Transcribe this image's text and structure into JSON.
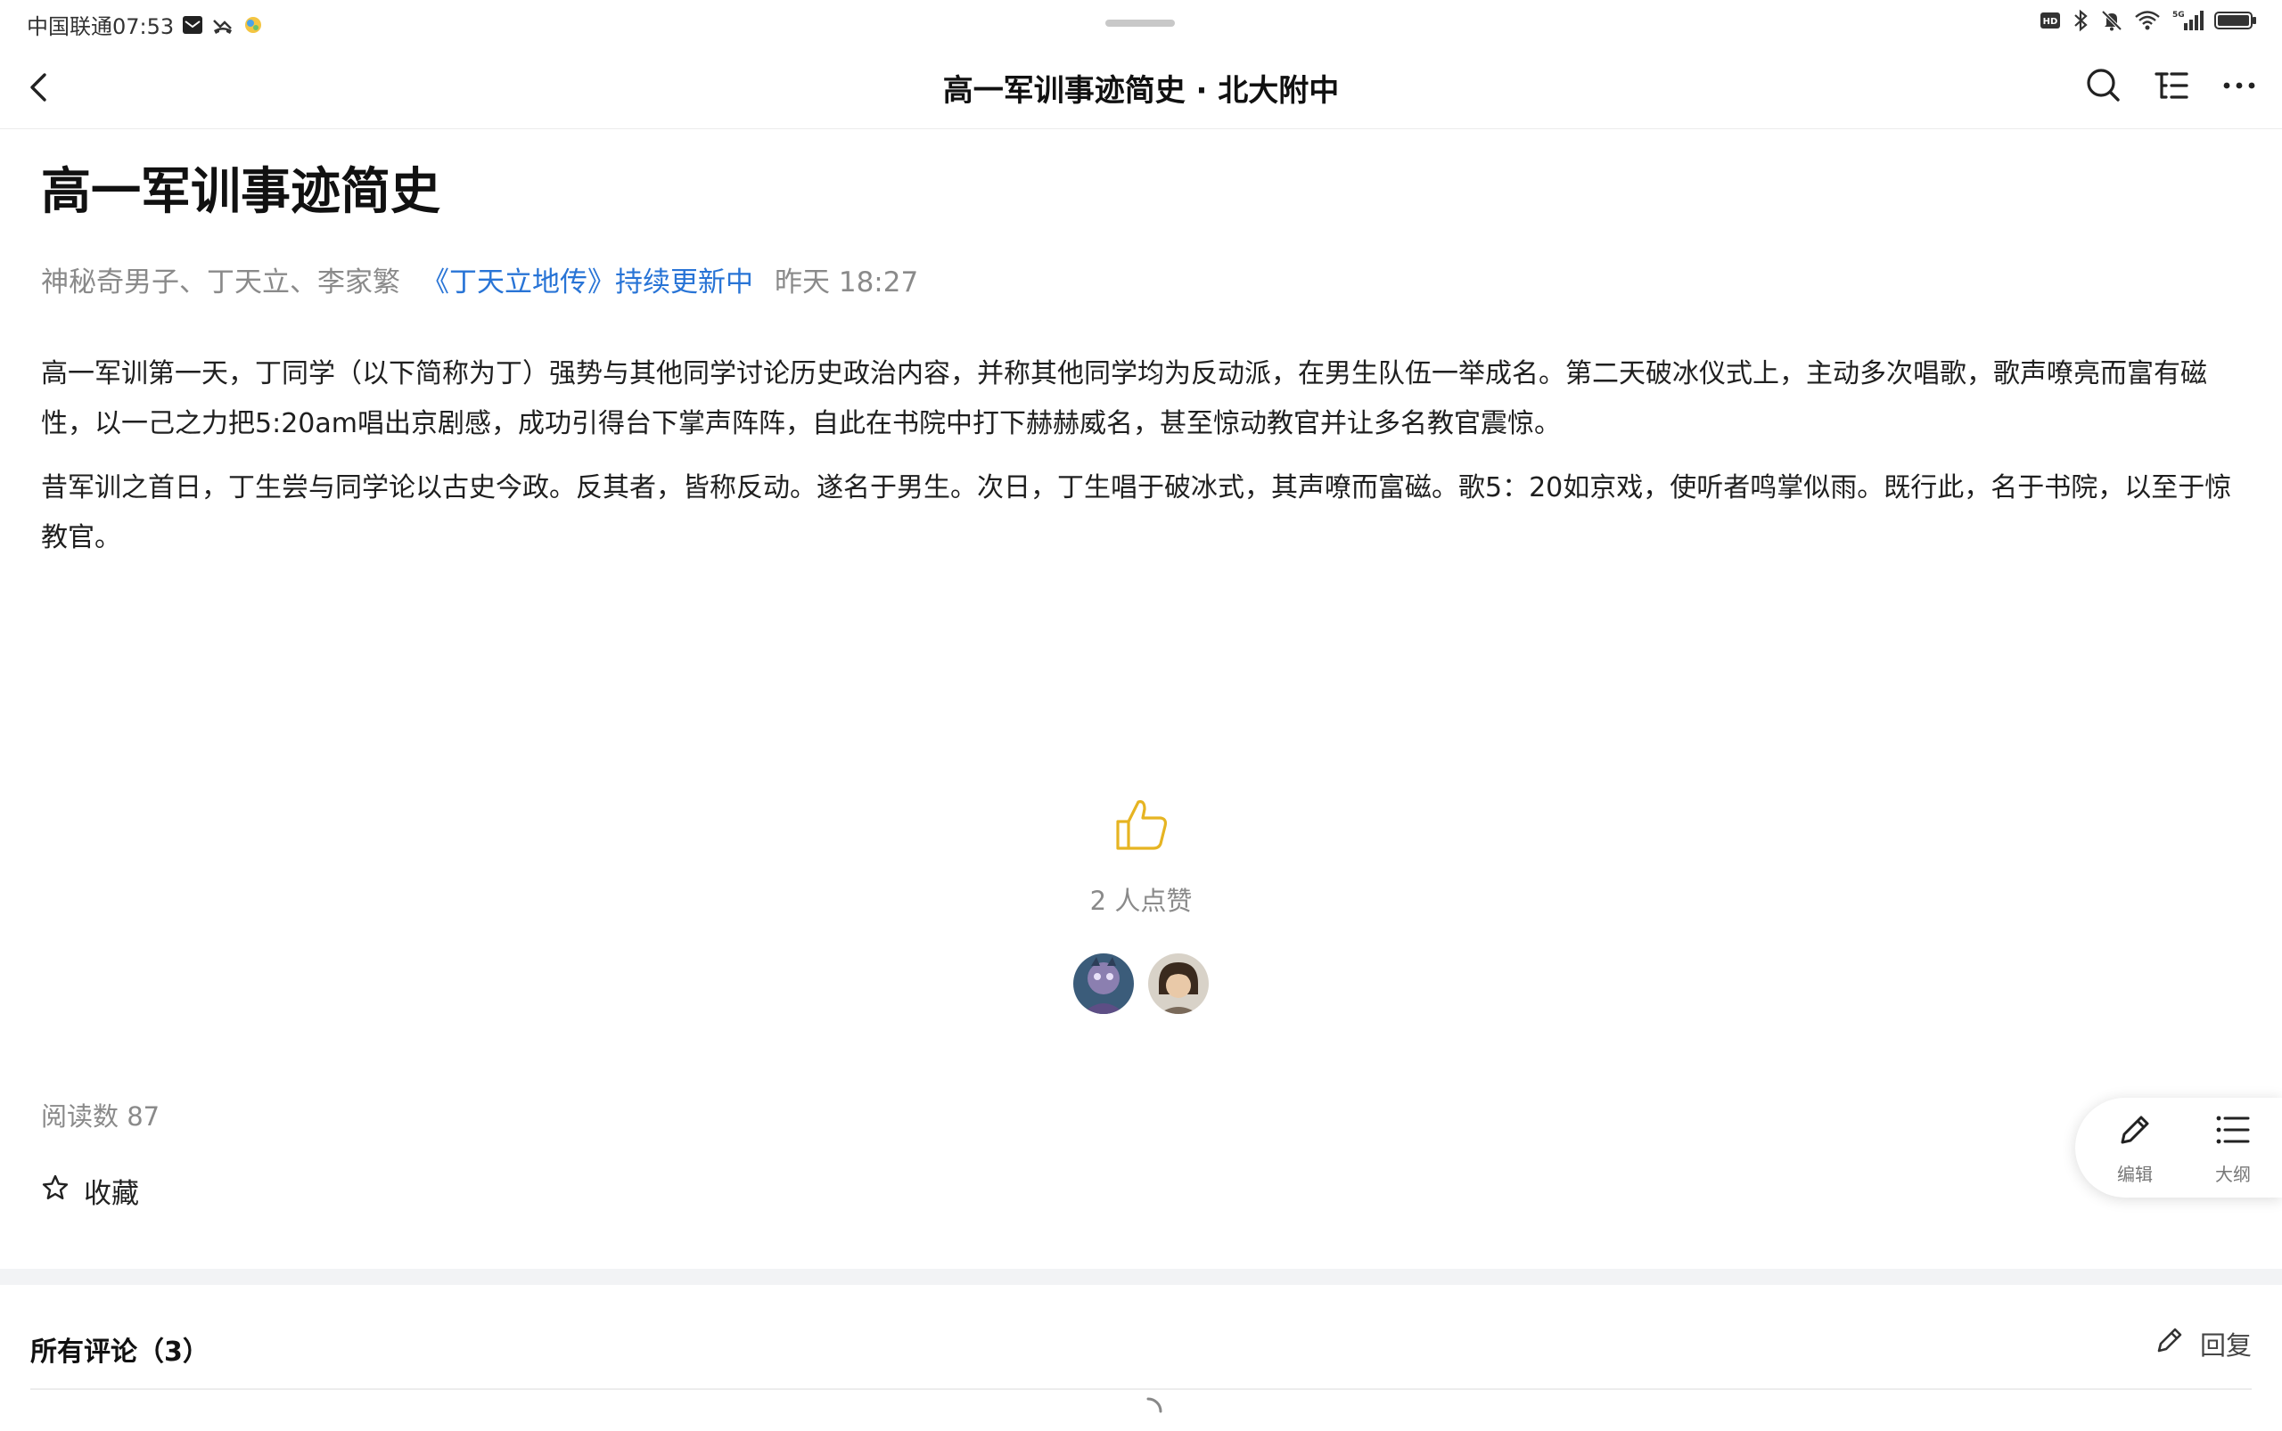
{
  "status_bar": {
    "carrier_time": "中国联通07:53",
    "left_icons": [
      "mail-icon",
      "missed-call-icon",
      "app-notification-icon"
    ],
    "right_icons": [
      "hd-icon",
      "bluetooth-icon",
      "mute-icon",
      "wifi-icon",
      "signal-icon",
      "battery-icon"
    ]
  },
  "top_bar": {
    "title": "高一军训事迹简史 · 北大附中",
    "icons": [
      "back-icon",
      "search-icon",
      "outline-icon",
      "more-icon"
    ]
  },
  "article": {
    "title": "高一军训事迹简史",
    "authors": "神秘奇男子、丁天立、李家繁",
    "series": "《丁天立地传》持续更新中",
    "time": "昨天 18:27",
    "paragraphs": [
      "高一军训第一天，丁同学（以下简称为丁）强势与其他同学讨论历史政治内容，并称其他同学均为反动派，在男生队伍一举成名。第二天破冰仪式上，主动多次唱歌，歌声嘹亮而富有磁性，以一己之力把5:20am唱出京剧感，成功引得台下掌声阵阵，自此在书院中打下赫赫威名，甚至惊动教官并让多名教官震惊。",
      "昔军训之首日，丁生尝与同学论以古史今政。反其者，皆称反动。遂名于男生。次日，丁生唱于破冰式，其声嘹而富磁。歌5：20如京戏，使听者鸣掌似雨。既行此，名于书院，以至于惊教官。"
    ]
  },
  "likes": {
    "count_text": "2 人点赞",
    "icon": "thumbs-up-icon",
    "color": "#e6b422"
  },
  "stats": {
    "read_count": "阅读数 87"
  },
  "favorite": {
    "label": "收藏",
    "icon": "star-icon"
  },
  "float_panel": {
    "edit_label": "编辑",
    "outline_label": "大纲"
  },
  "comments": {
    "title": "所有评论（3）",
    "reply_label": "回复"
  },
  "colors": {
    "link": "#2874d6",
    "muted": "#8a8a8a",
    "like": "#e6b422"
  }
}
